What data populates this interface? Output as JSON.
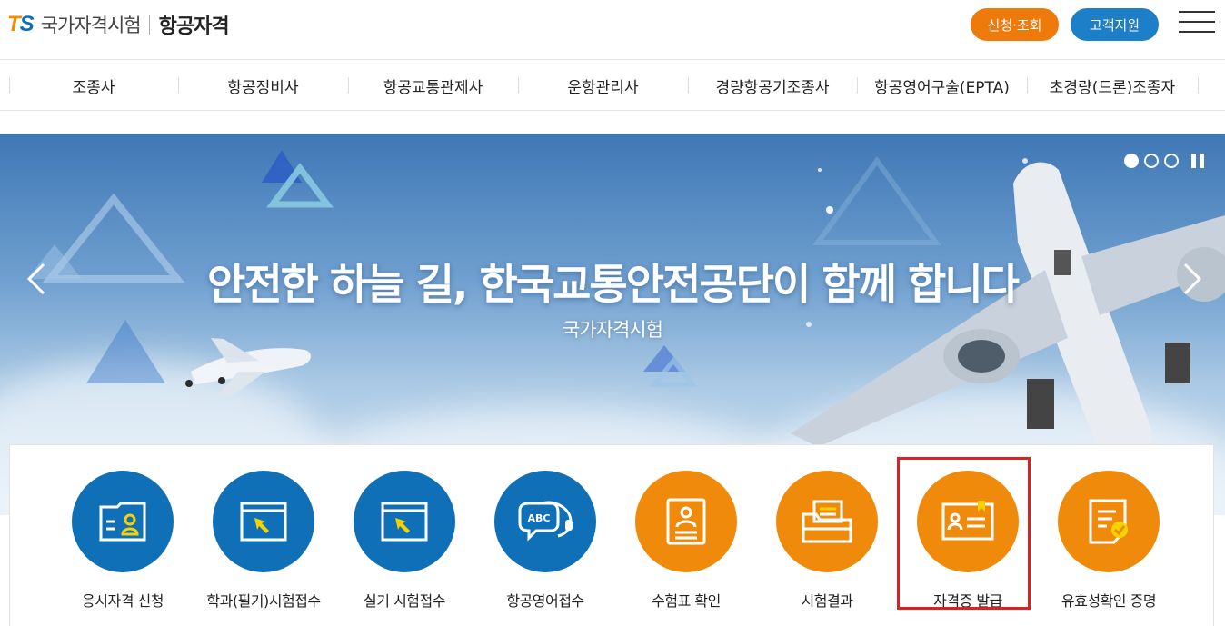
{
  "header": {
    "logo_mark_t": "T",
    "logo_mark_s": "S",
    "org_name": "국가자격시험",
    "site_title": "항공자격",
    "apply_label": "신청·조회",
    "support_label": "고객지원"
  },
  "gnb": {
    "items": [
      {
        "label": "조종사"
      },
      {
        "label": "항공정비사"
      },
      {
        "label": "항공교통관제사"
      },
      {
        "label": "운항관리사"
      },
      {
        "label": "경량항공기조종사"
      },
      {
        "label": "항공영어구술(EPTA)"
      },
      {
        "label": "초경량(드론)조종자"
      }
    ]
  },
  "hero": {
    "title": "안전한 하늘 길, 한국교통안전공단이 함께 합니다",
    "subtitle": "국가자격시험",
    "slide_count": 3,
    "active_slide": 1
  },
  "quick_menu": {
    "items": [
      {
        "label": "응시자격 신청",
        "color": "#0f6fb7",
        "icon": "id-card-icon"
      },
      {
        "label": "학과(필기)시험접수",
        "color": "#0f6fb7",
        "icon": "cursor-window-icon"
      },
      {
        "label": "실기 시험접수",
        "color": "#0f6fb7",
        "icon": "cursor-window-icon"
      },
      {
        "label": "항공영어접수",
        "color": "#0f6fb7",
        "icon": "abc-headset-icon"
      },
      {
        "label": "수험표 확인",
        "color": "#f08a0b",
        "icon": "admission-ticket-icon"
      },
      {
        "label": "시험결과",
        "color": "#f08a0b",
        "icon": "folder-icon"
      },
      {
        "label": "자격증 발급",
        "color": "#f08a0b",
        "icon": "license-card-icon"
      },
      {
        "label": "유효성확인 증명",
        "color": "#f08a0b",
        "icon": "verified-document-icon"
      }
    ]
  },
  "colors": {
    "brand_orange": "#ee7a0c",
    "brand_blue": "#1c7fc7",
    "highlight_red": "#e01f1f"
  }
}
